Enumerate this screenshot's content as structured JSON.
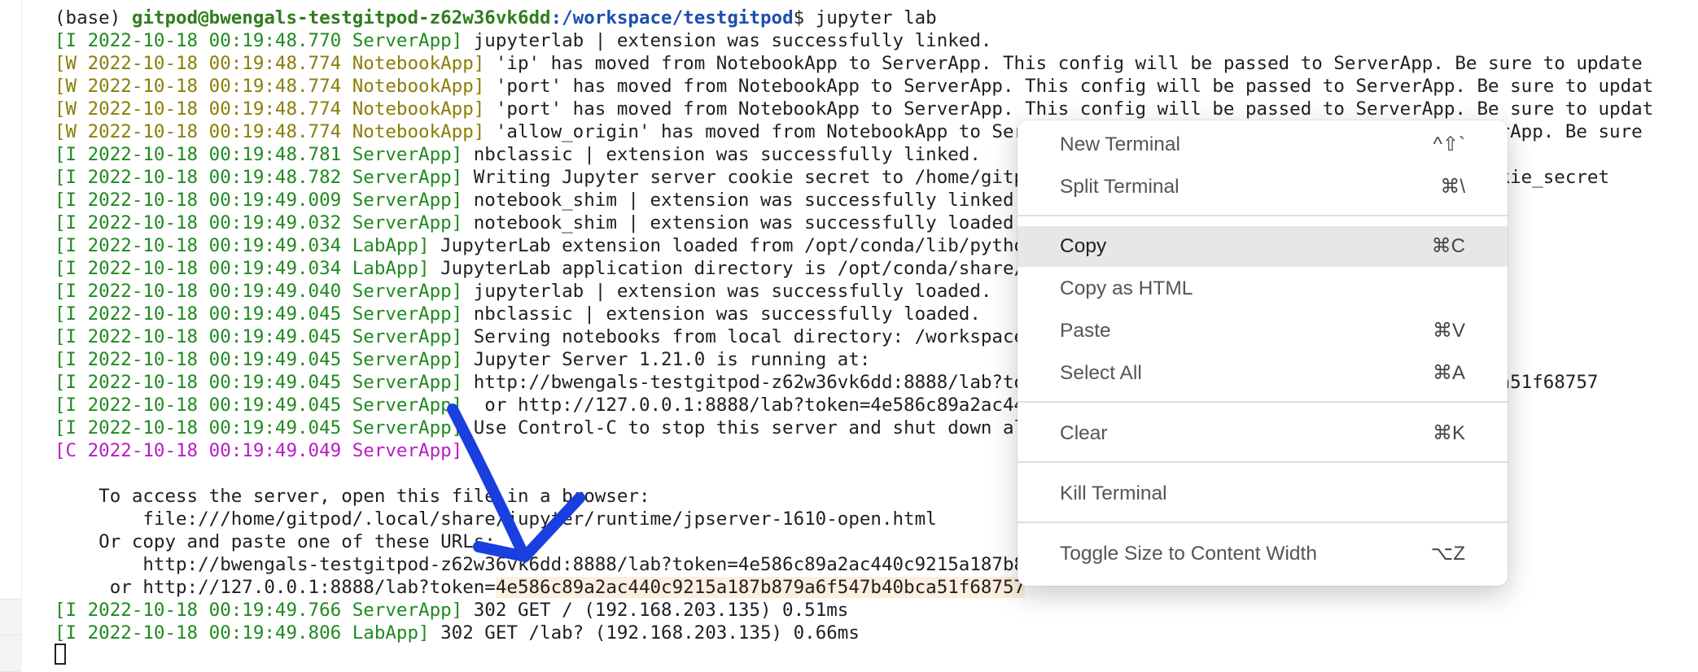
{
  "terminal": {
    "prompt": {
      "env": "(base) ",
      "user_host": "gitpod@bwengals-testgitpod-z62w36vk6dd",
      "path": ":/workspace/testgitpod",
      "command": "$ jupyter lab"
    },
    "log": [
      {
        "level": "I",
        "tag": "[I 2022-10-18 00:19:48.770 ServerApp]",
        "msg": " jupyterlab | extension was successfully linked."
      },
      {
        "level": "W",
        "tag": "[W 2022-10-18 00:19:48.774 NotebookApp]",
        "msg": " 'ip' has moved from NotebookApp to ServerApp. This config will be passed to ServerApp. Be sure to update"
      },
      {
        "level": "W",
        "tag": "[W 2022-10-18 00:19:48.774 NotebookApp]",
        "msg": " 'port' has moved from NotebookApp to ServerApp. This config will be passed to ServerApp. Be sure to updat"
      },
      {
        "level": "W",
        "tag": "[W 2022-10-18 00:19:48.774 NotebookApp]",
        "msg": " 'port' has moved from NotebookApp to ServerApp. This config will be passed to ServerApp. Be sure to updat"
      },
      {
        "level": "W",
        "tag": "[W 2022-10-18 00:19:48.774 NotebookApp]",
        "msg": " 'allow_origin' has moved from NotebookApp to ServerApp. This config will be passed to ServerApp. Be sure"
      },
      {
        "level": "I",
        "tag": "[I 2022-10-18 00:19:48.781 ServerApp]",
        "msg": " nbclassic | extension was successfully linked."
      },
      {
        "level": "I",
        "tag": "[I 2022-10-18 00:19:48.782 ServerApp]",
        "msg": " Writing Jupyter server cookie secret to /home/gitpod/.local/share/jupyter/runtime/jupyter_cookie_secret"
      },
      {
        "level": "I",
        "tag": "[I 2022-10-18 00:19:49.009 ServerApp]",
        "msg": " notebook_shim | extension was successfully linked."
      },
      {
        "level": "I",
        "tag": "[I 2022-10-18 00:19:49.032 ServerApp]",
        "msg": " notebook_shim | extension was successfully loaded."
      },
      {
        "level": "I",
        "tag": "[I 2022-10-18 00:19:49.034 LabApp]",
        "msg": " JupyterLab extension loaded from /opt/conda/lib/python3.10/site-packages/jupyterlab"
      },
      {
        "level": "I",
        "tag": "[I 2022-10-18 00:19:49.034 LabApp]",
        "msg": " JupyterLab application directory is /opt/conda/share/jupyter/lab"
      },
      {
        "level": "I",
        "tag": "[I 2022-10-18 00:19:49.040 ServerApp]",
        "msg": " jupyterlab | extension was successfully loaded."
      },
      {
        "level": "I",
        "tag": "[I 2022-10-18 00:19:49.045 ServerApp]",
        "msg": " nbclassic | extension was successfully loaded."
      },
      {
        "level": "I",
        "tag": "[I 2022-10-18 00:19:49.045 ServerApp]",
        "msg": " Serving notebooks from local directory: /workspace/testgitpod"
      },
      {
        "level": "I",
        "tag": "[I 2022-10-18 00:19:49.045 ServerApp]",
        "msg": " Jupyter Server 1.21.0 is running at:"
      },
      {
        "level": "I",
        "tag": "[I 2022-10-18 00:19:49.045 ServerApp]",
        "msg": " http://bwengals-testgitpod-z62w36vk6dd:8888/lab?token=4e586c89a2ac440c9215a187b879a6f547b40bca51f68757"
      },
      {
        "level": "I",
        "tag": "[I 2022-10-18 00:19:49.045 ServerApp]",
        "msg": "  or http://127.0.0.1:8888/lab?token=4e586c89a2ac440c9215a187b879a6f547b40bca51f68757"
      },
      {
        "level": "I",
        "tag": "[I 2022-10-18 00:19:49.045 ServerApp]",
        "msg": " Use Control-C to stop this server and shut down all kernels (twice to skip confirmation)."
      },
      {
        "level": "C",
        "tag": "[C 2022-10-18 00:19:49.049 ServerApp]",
        "msg": ""
      }
    ],
    "access": {
      "line1": "    To access the server, open this file in a browser:",
      "line2": "        file:///home/gitpod/.local/share/jupyter/runtime/jpserver-1610-open.html",
      "line3": "    Or copy and paste one of these URLs:",
      "line4": "        http://bwengals-testgitpod-z62w36vk6dd:8888/lab?token=4e586c89a2ac440c9215a187b879a6f547b40bca51f68757",
      "line5_prefix": "     or http://127.0.0.1:8888/lab?token=",
      "line5_token": "4e586c89a2ac440c9215a187b879a6f547b40bca51f68757"
    },
    "tail": [
      {
        "level": "I",
        "tag": "[I 2022-10-18 00:19:49.766 ServerApp]",
        "msg": " 302 GET / (192.168.203.135) 0.51ms"
      },
      {
        "level": "I",
        "tag": "[I 2022-10-18 00:19:49.806 LabApp]",
        "msg": " 302 GET /lab? (192.168.203.135) 0.66ms"
      }
    ]
  },
  "context_menu": {
    "items": [
      {
        "label": "New Terminal",
        "shortcut": "^⇧`"
      },
      {
        "label": "Split Terminal",
        "shortcut": "⌘\\"
      },
      {
        "label": "Copy",
        "shortcut": "⌘C"
      },
      {
        "label": "Copy as HTML",
        "shortcut": ""
      },
      {
        "label": "Paste",
        "shortcut": "⌘V"
      },
      {
        "label": "Select All",
        "shortcut": "⌘A"
      },
      {
        "label": "Clear",
        "shortcut": "⌘K"
      },
      {
        "label": "Kill Terminal",
        "shortcut": ""
      },
      {
        "label": "Toggle Size to Content Width",
        "shortcut": "⌥Z"
      }
    ]
  },
  "colors": {
    "info": "#1f8a1f",
    "warn": "#8a7e06",
    "critical": "#b81cc4",
    "arrow": "#1a3fe0",
    "highlight": "#fdeede"
  }
}
